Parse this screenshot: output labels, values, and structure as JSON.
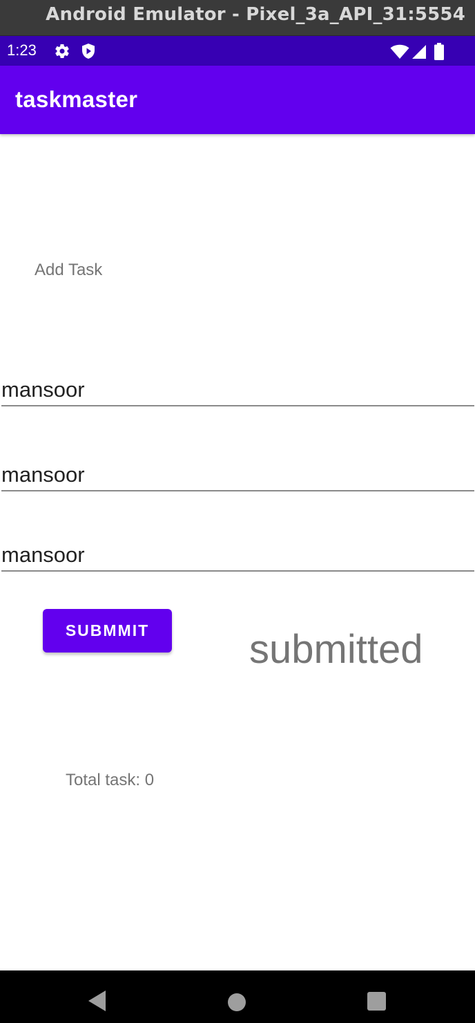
{
  "window": {
    "title": "Android Emulator - Pixel_3a_API_31:5554"
  },
  "status_bar": {
    "time": "1:23",
    "icons": [
      "gear-icon",
      "shield-icon",
      "wifi-icon",
      "signal-icon",
      "battery-icon"
    ]
  },
  "app_bar": {
    "title": "taskmaster"
  },
  "form": {
    "heading": "Add Task",
    "fields": [
      {
        "value": "mansoor"
      },
      {
        "value": "mansoor"
      },
      {
        "value": "mansoor"
      }
    ],
    "submit_label": "SUBMMIT",
    "status_text": "submitted",
    "total_task": "Total task: 0"
  },
  "nav_bar": {
    "icons": [
      "back-icon",
      "home-icon",
      "recents-icon"
    ]
  },
  "colors": {
    "primary": "#6200ee",
    "primary_dark": "#3700b3",
    "secondary_text": "#757575"
  }
}
